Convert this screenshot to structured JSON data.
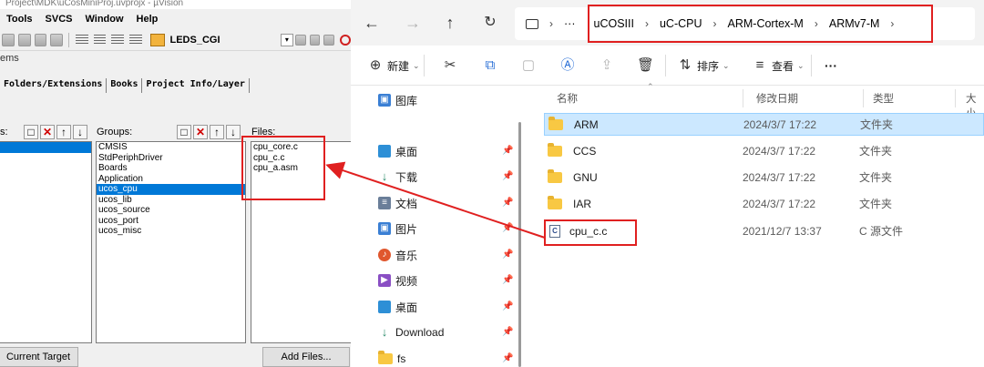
{
  "keil": {
    "title": "Project\\MDK\\uCosMiniProj.uvprojx - µVision",
    "menu": [
      "Tools",
      "SVCS",
      "Window",
      "Help"
    ],
    "target_name": "LEDS_CGI",
    "items_label": "ems",
    "tabs": [
      "Folders/Extensions",
      "Books",
      "Project Info/Layer"
    ],
    "groups_label": "Groups:",
    "files_label": "Files:",
    "targets_label": "s:",
    "groups": [
      "CMSIS",
      "StdPeriphDriver",
      "Boards",
      "Application",
      "ucos_cpu",
      "ucos_lib",
      "ucos_source",
      "ucos_port",
      "ucos_misc"
    ],
    "selected_group": "ucos_cpu",
    "files": [
      "cpu_core.c",
      "cpu_c.c",
      "cpu_a.asm"
    ],
    "current_target_button": "Current Target",
    "add_files_button": "Add Files...",
    "accent": "#0078d7"
  },
  "explorer": {
    "breadcrumb": [
      "uCOSIII",
      "uC-CPU",
      "ARM-Cortex-M",
      "ARMv7-M"
    ],
    "ellipsis": "···",
    "new_label": "新建",
    "sort_label": "排序",
    "view_label": "查看",
    "more_label": "···",
    "nav": [
      {
        "label": "图库",
        "icon": "gallery-icon",
        "pinned": false
      },
      {
        "label": "桌面",
        "icon": "desktop-icon",
        "pinned": true
      },
      {
        "label": "下载",
        "icon": "download-icon",
        "pinned": true
      },
      {
        "label": "文档",
        "icon": "document-icon",
        "pinned": true
      },
      {
        "label": "图片",
        "icon": "picture-icon",
        "pinned": true
      },
      {
        "label": "音乐",
        "icon": "music-icon",
        "pinned": true
      },
      {
        "label": "视频",
        "icon": "video-icon",
        "pinned": true
      },
      {
        "label": "桌面",
        "icon": "desktop-icon",
        "pinned": true
      },
      {
        "label": "Download",
        "icon": "download-icon",
        "pinned": true
      },
      {
        "label": "fs",
        "icon": "folder-icon",
        "pinned": true
      }
    ],
    "columns": {
      "name": "名称",
      "date": "修改日期",
      "type": "类型",
      "size": "大小"
    },
    "files": [
      {
        "name": "ARM",
        "date": "2024/3/7 17:22",
        "type": "文件夹",
        "kind": "folder",
        "selected": true
      },
      {
        "name": "CCS",
        "date": "2024/3/7 17:22",
        "type": "文件夹",
        "kind": "folder",
        "selected": false
      },
      {
        "name": "GNU",
        "date": "2024/3/7 17:22",
        "type": "文件夹",
        "kind": "folder",
        "selected": false
      },
      {
        "name": "IAR",
        "date": "2024/3/7 17:22",
        "type": "文件夹",
        "kind": "folder",
        "selected": false
      },
      {
        "name": "cpu_c.c",
        "date": "2021/12/7 13:37",
        "type": "C 源文件",
        "kind": "c-file",
        "selected": false
      }
    ],
    "highlight_color": "#cce8ff"
  },
  "annotation_color": "#e02020"
}
